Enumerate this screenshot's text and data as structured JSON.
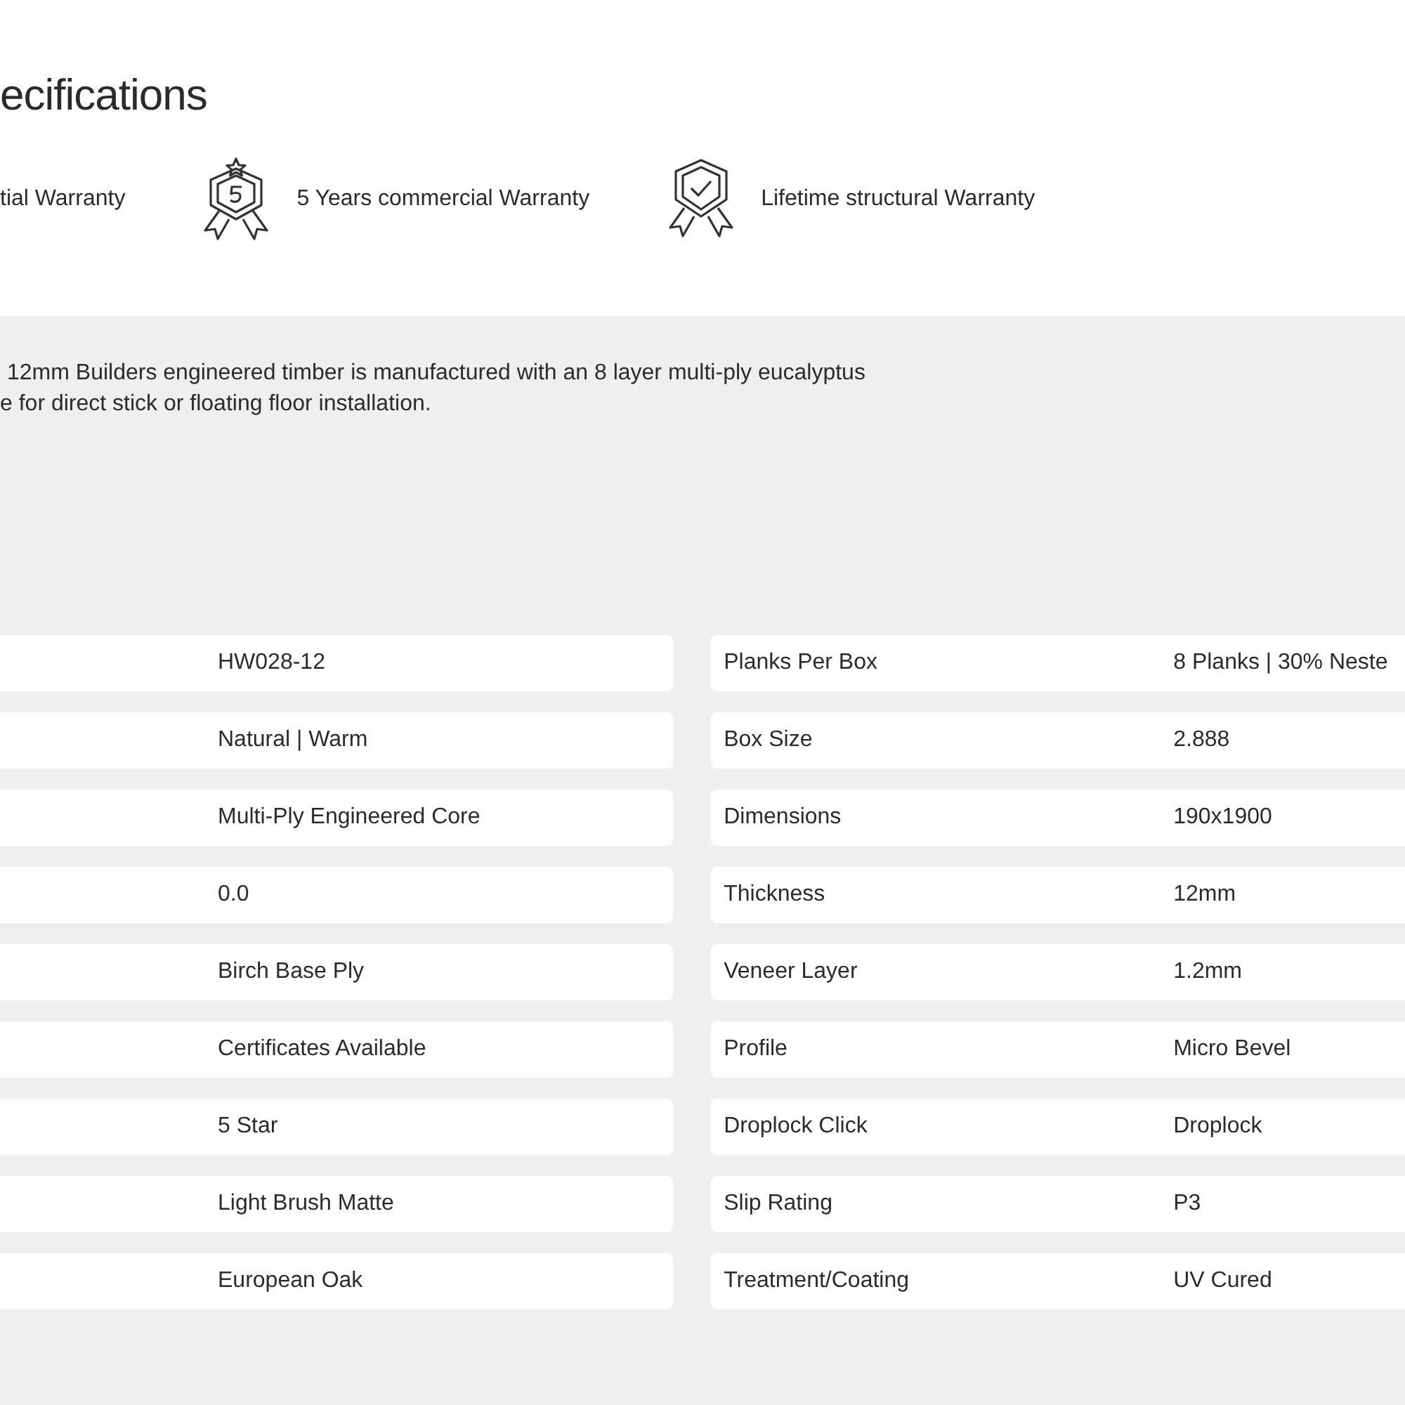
{
  "heading": "ecifications",
  "warranties": [
    {
      "label": "tial Warranty",
      "kind": "plain"
    },
    {
      "label": "5 Years commercial Warranty",
      "kind": "award"
    },
    {
      "label": "Lifetime structural Warranty",
      "kind": "shield"
    }
  ],
  "description": [
    "12mm Builders engineered timber is manufactured with an 8 layer multi-ply eucalyptus",
    "e for direct stick or floating floor installation."
  ],
  "specs_left": [
    {
      "value": "HW028-12"
    },
    {
      "value": "Natural | Warm"
    },
    {
      "value": "Multi-Ply Engineered Core"
    },
    {
      "value": "0.0"
    },
    {
      "value": "Birch Base Ply"
    },
    {
      "value": "Certificates Available"
    },
    {
      "value": "5 Star"
    },
    {
      "value": "Light Brush Matte"
    },
    {
      "value": "European Oak"
    }
  ],
  "specs_right": [
    {
      "label": "Planks Per Box",
      "value": "8 Planks | 30% Neste"
    },
    {
      "label": "Box Size",
      "value": "2.888"
    },
    {
      "label": "Dimensions",
      "value": "190x1900"
    },
    {
      "label": "Thickness",
      "value": "12mm"
    },
    {
      "label": "Veneer Layer",
      "value": "1.2mm"
    },
    {
      "label": "Profile",
      "value": "Micro Bevel"
    },
    {
      "label": "Droplock Click",
      "value": "Droplock"
    },
    {
      "label": "Slip Rating",
      "value": "P3"
    },
    {
      "label": "Treatment/Coating",
      "value": "UV Cured"
    }
  ]
}
